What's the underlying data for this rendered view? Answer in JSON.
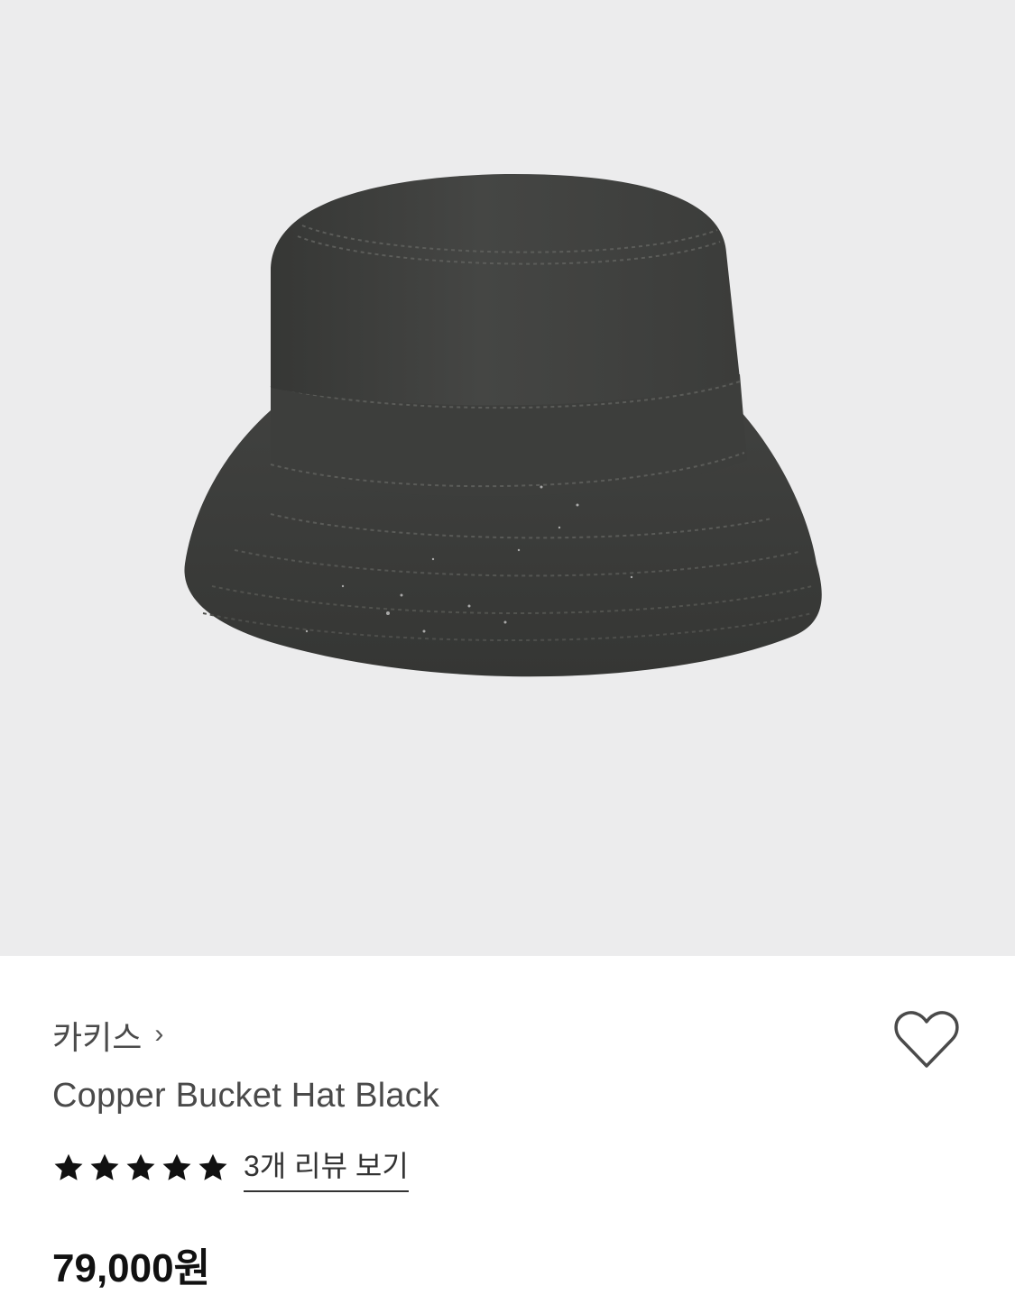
{
  "product": {
    "image_alt": "Copper Bucket Hat Black",
    "brand": "카키스",
    "brand_chevron": "›",
    "name": "Copper Bucket Hat Black",
    "rating": 5,
    "rating_max": 5,
    "review_link": "3개 리뷰 보기",
    "price": "79,000원"
  },
  "icons": {
    "brand_chevron": "chevron-right-icon",
    "wishlist": "heart-outline-icon",
    "star": "star-filled-icon"
  },
  "colors": {
    "image_background": "#ececed",
    "hat": "#3f403e",
    "text_primary": "#111111",
    "text_secondary": "#4a4a4a"
  }
}
